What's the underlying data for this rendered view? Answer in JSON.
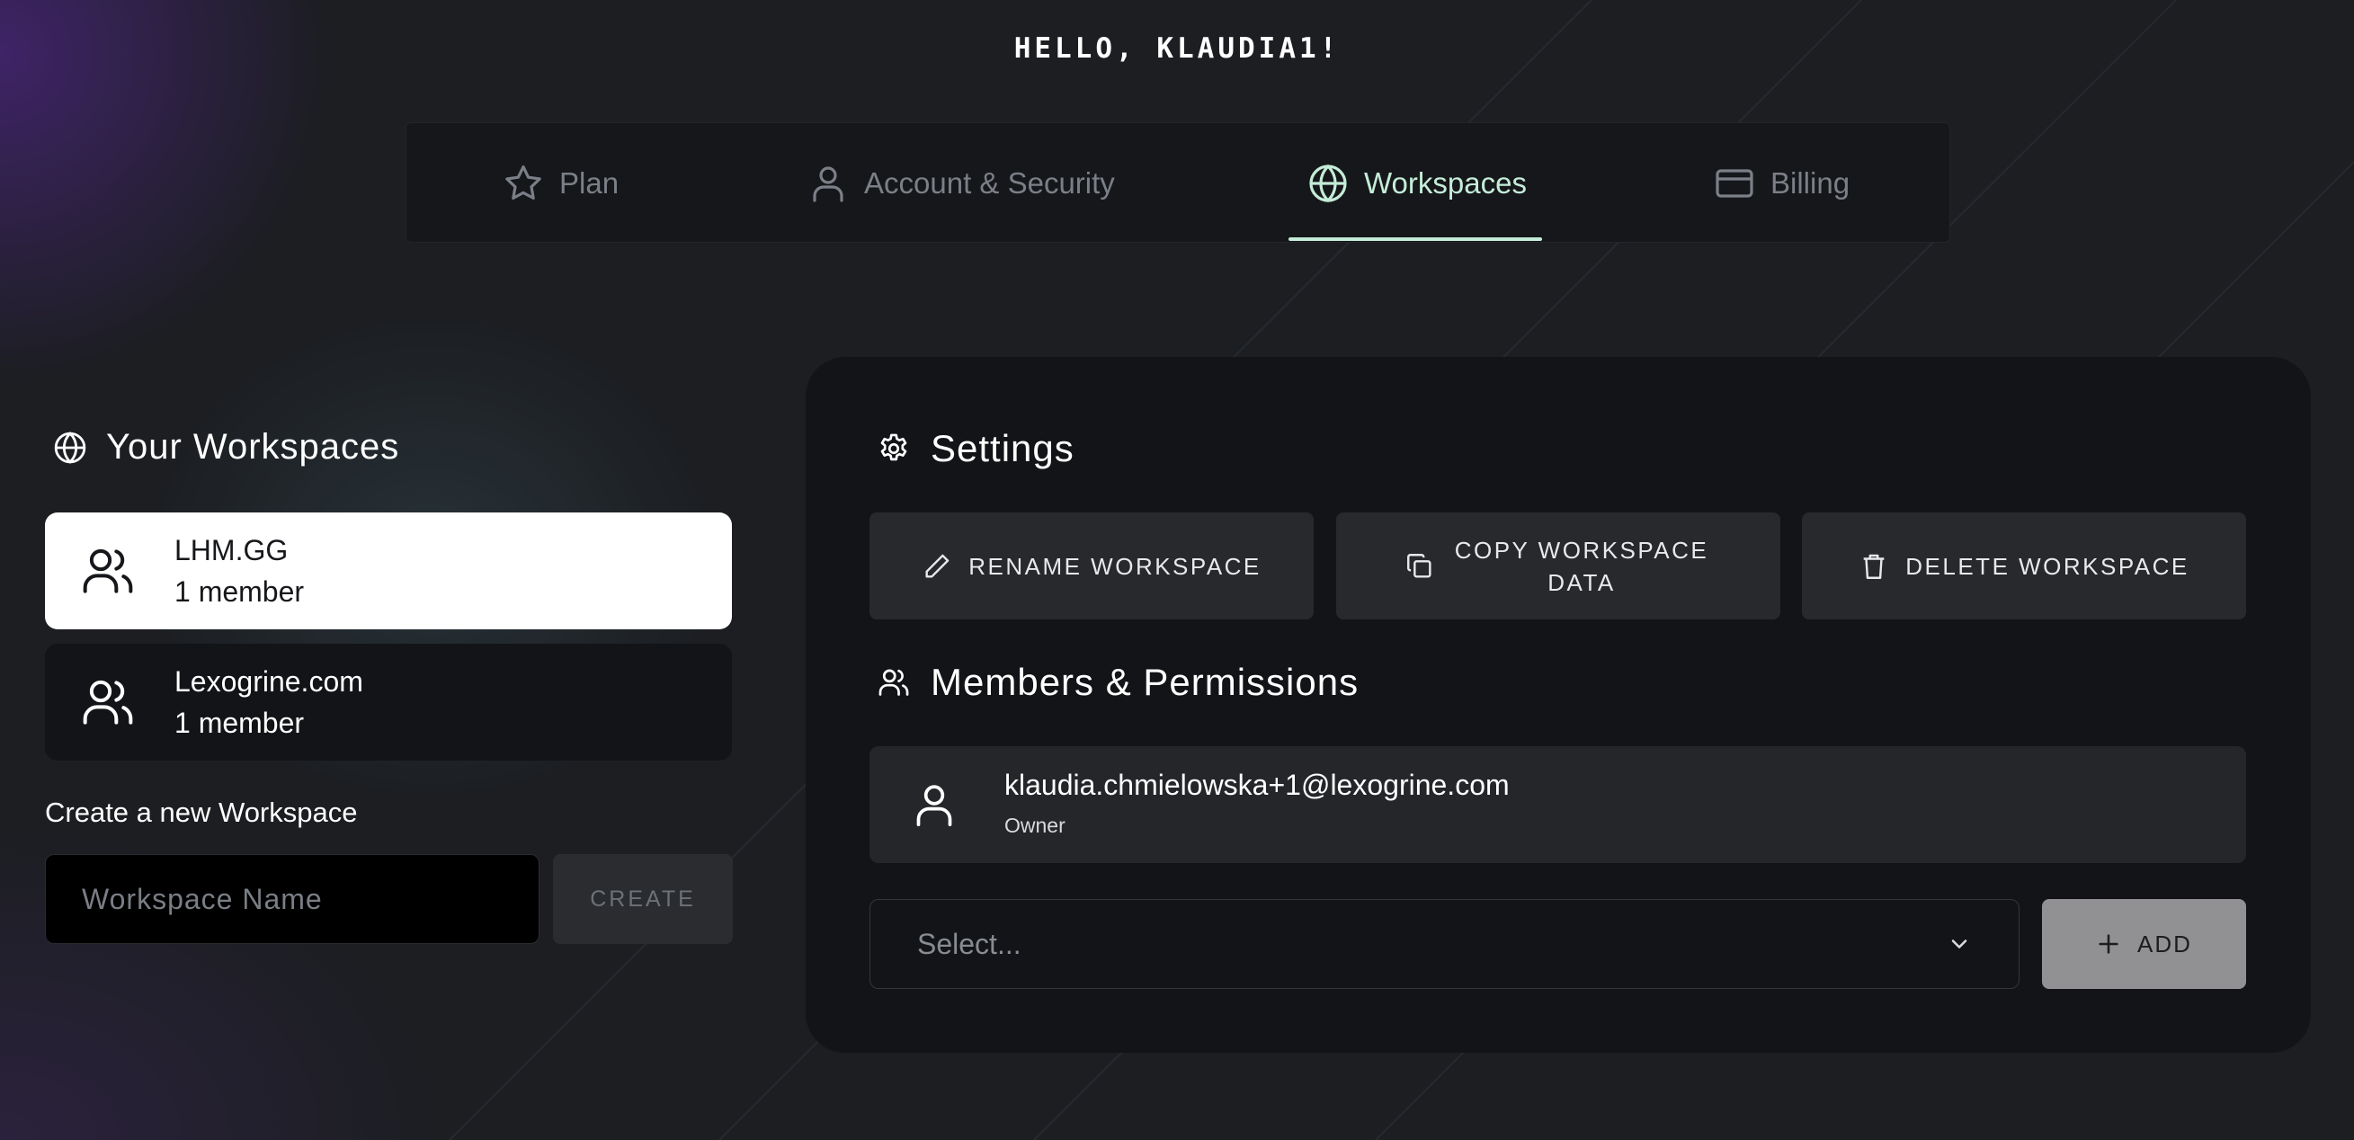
{
  "greeting": "HELLO, KLAUDIA1!",
  "tabs": [
    {
      "label": "Plan",
      "icon": "star-icon"
    },
    {
      "label": "Account & Security",
      "icon": "user-icon"
    },
    {
      "label": "Workspaces",
      "icon": "globe-icon",
      "active": true
    },
    {
      "label": "Billing",
      "icon": "credit-card-icon"
    }
  ],
  "workspaces": {
    "title": "Your Workspaces",
    "items": [
      {
        "name": "LHM.GG",
        "members": "1 member",
        "selected": true
      },
      {
        "name": "Lexogrine.com",
        "members": "1 member",
        "selected": false
      }
    ],
    "create_label": "Create a new Workspace",
    "input_placeholder": "Workspace Name",
    "create_button": "CREATE"
  },
  "settings": {
    "title": "Settings",
    "rename_button": "RENAME WORKSPACE",
    "copy_button": "COPY WORKSPACE DATA",
    "delete_button": "DELETE WORKSPACE"
  },
  "members": {
    "title": "Members & Permissions",
    "list": [
      {
        "email": "klaudia.chmielowska+1@lexogrine.com",
        "role": "Owner"
      }
    ],
    "select_placeholder": "Select...",
    "add_button": "ADD"
  },
  "colors": {
    "accent": "#c4ecd8",
    "background": "#1c1e22",
    "panel": "#131417"
  }
}
